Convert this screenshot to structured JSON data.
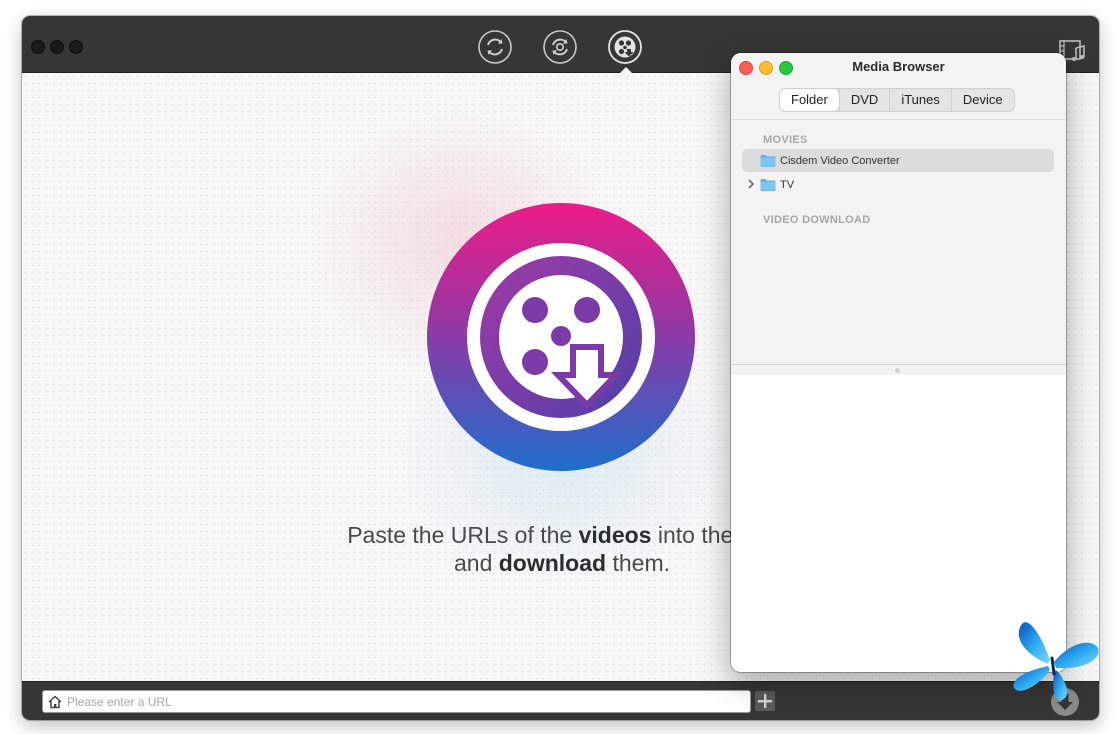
{
  "app": {
    "toolbar": {
      "modes": [
        {
          "name": "convert",
          "icon": "convert-arrows-icon",
          "active": false
        },
        {
          "name": "rip",
          "icon": "rip-disc-icon",
          "active": false
        },
        {
          "name": "download",
          "icon": "download-film-reel-icon",
          "active": true
        }
      ],
      "media_browser_icon": "film-music-icon"
    },
    "main": {
      "instruction_prefix": "Paste the URLs of the ",
      "instruction_bold1": "videos",
      "instruction_mid": " into the box",
      "instruction_line2_prefix": "and ",
      "instruction_bold2": "download",
      "instruction_suffix": " them.",
      "logo_gradient": [
        "#e91e8c",
        "#7b3aa8",
        "#1f7ed1"
      ]
    },
    "bottombar": {
      "url_placeholder": "Please enter a URL",
      "url_value": "",
      "home_icon": "home-icon",
      "add_icon": "plus-icon",
      "download_icon": "download-arrow-icon"
    }
  },
  "media_browser": {
    "title": "Media Browser",
    "tabs": [
      {
        "label": "Folder",
        "active": true
      },
      {
        "label": "DVD",
        "active": false
      },
      {
        "label": "iTunes",
        "active": false
      },
      {
        "label": "Device",
        "active": false
      }
    ],
    "sections": [
      {
        "header": "MOVIES",
        "items": [
          {
            "label": "Cisdem Video Converter",
            "selected": true,
            "expandable": false
          },
          {
            "label": "TV",
            "selected": false,
            "expandable": true
          }
        ]
      },
      {
        "header": "VIDEO DOWNLOAD",
        "items": []
      }
    ],
    "traffic_lights": [
      "#fe5f57",
      "#febc2e",
      "#28c840"
    ]
  },
  "desktop": {
    "dock_icon": "butterfly-icon"
  }
}
